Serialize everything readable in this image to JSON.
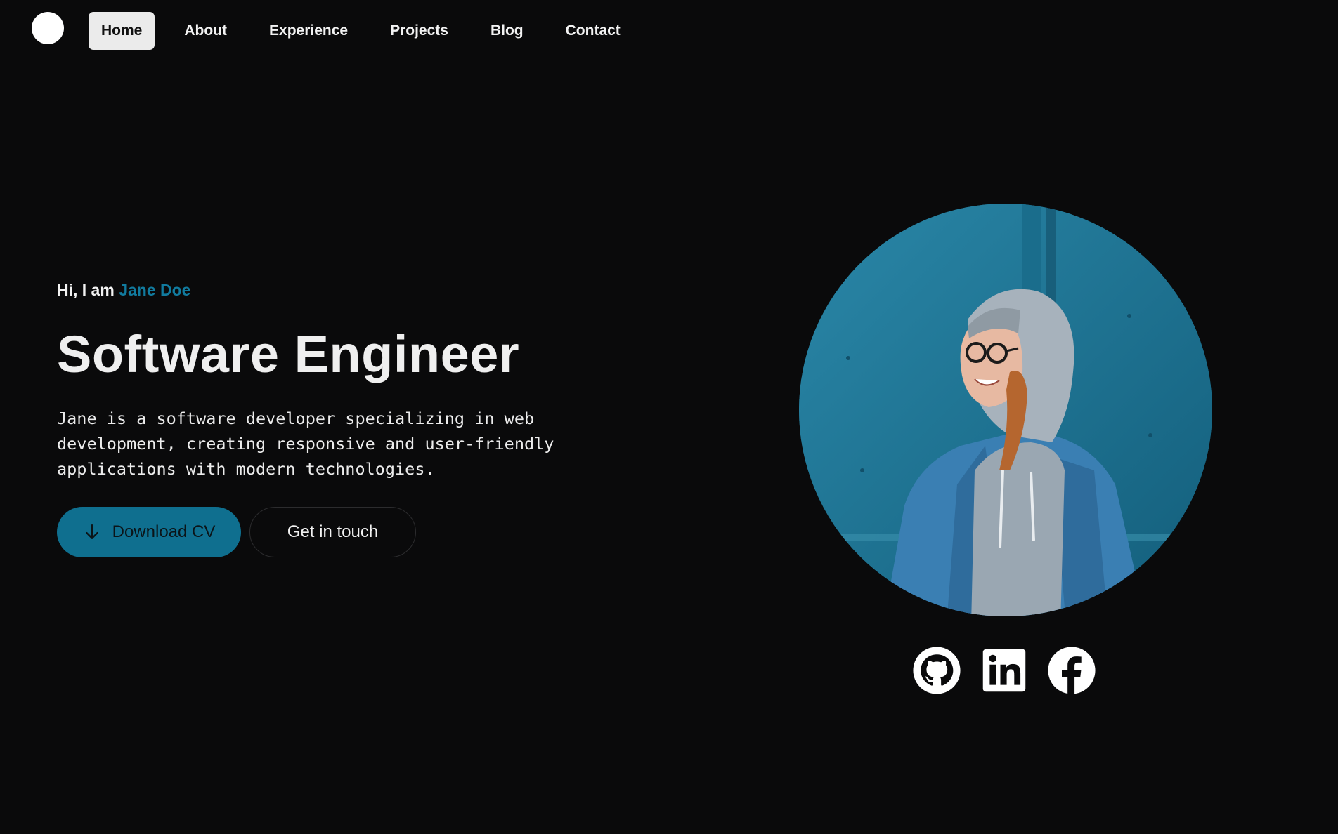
{
  "nav": {
    "logo_icon": "circle-logo",
    "links": [
      {
        "label": "Home",
        "active": true
      },
      {
        "label": "About",
        "active": false
      },
      {
        "label": "Experience",
        "active": false
      },
      {
        "label": "Projects",
        "active": false
      },
      {
        "label": "Blog",
        "active": false
      },
      {
        "label": "Contact",
        "active": false
      }
    ]
  },
  "hero": {
    "greeting_prefix": "Hi, I am",
    "name": "Jane Doe",
    "title": "Software Engineer",
    "bio": "Jane is a software developer specializing in web development, creating responsive and user-friendly applications with modern technologies.",
    "primary_button": {
      "label": "Download CV",
      "icon": "arrow-down-icon"
    },
    "secondary_button": {
      "label": "Get in touch"
    }
  },
  "portrait": {
    "description_icon": "profile-photo"
  },
  "socials": [
    {
      "icon": "github-icon"
    },
    {
      "icon": "linkedin-icon"
    },
    {
      "icon": "facebook-icon"
    }
  ],
  "colors": {
    "background": "#0a0a0b",
    "accent": "#117b9f",
    "button_primary": "#0f6f8f",
    "nav_active_bg": "#ebebeb"
  }
}
